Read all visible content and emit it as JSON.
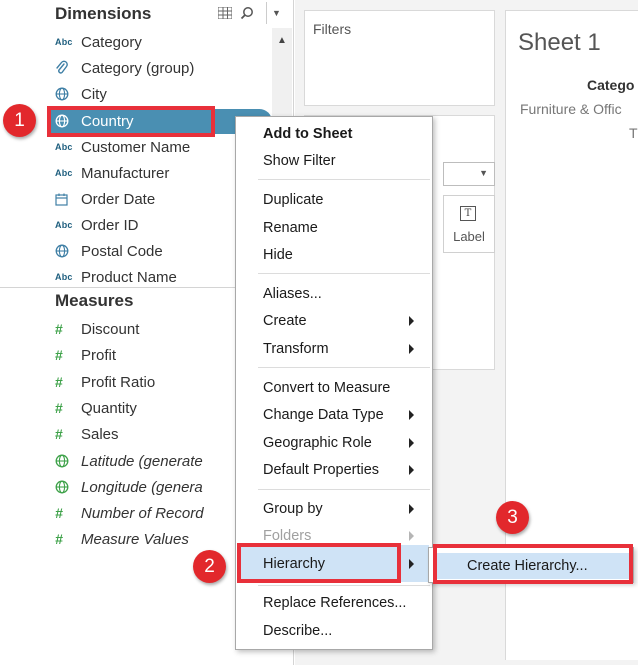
{
  "data_pane": {
    "dimensions_title": "Dimensions",
    "measures_title": "Measures",
    "tool_icons": [
      "view-toggle-icon",
      "search-icon",
      "chevron-down-icon"
    ],
    "dimensions": [
      {
        "label": "Category",
        "type": "abc",
        "icon_text": "Abc"
      },
      {
        "label": "Category (group)",
        "type": "paperclip"
      },
      {
        "label": "City",
        "type": "globe"
      },
      {
        "label": "Country",
        "type": "globe",
        "selected": true
      },
      {
        "label": "Customer Name",
        "type": "abc",
        "icon_text": "Abc"
      },
      {
        "label": "Manufacturer",
        "type": "abc",
        "icon_text": "Abc"
      },
      {
        "label": "Order Date",
        "type": "calendar"
      },
      {
        "label": "Order ID",
        "type": "abc",
        "icon_text": "Abc"
      },
      {
        "label": "Postal Code",
        "type": "globe"
      },
      {
        "label": "Product Name",
        "type": "abc",
        "icon_text": "Abc"
      }
    ],
    "measures": [
      {
        "label": "Discount",
        "type": "hash",
        "icon_text": "#"
      },
      {
        "label": "Profit",
        "type": "hash",
        "icon_text": "#"
      },
      {
        "label": "Profit Ratio",
        "type": "hash",
        "icon_text": "#"
      },
      {
        "label": "Quantity",
        "type": "hash",
        "icon_text": "#"
      },
      {
        "label": "Sales",
        "type": "hash",
        "icon_text": "#"
      },
      {
        "label": "Latitude (generate",
        "type": "globe",
        "italic": true
      },
      {
        "label": "Longitude (genera",
        "type": "globe",
        "italic": true
      },
      {
        "label": "Number of Record",
        "type": "hash",
        "icon_text": "#",
        "italic": true
      },
      {
        "label": "Measure Values",
        "type": "hash",
        "icon_text": "#",
        "italic": true
      }
    ]
  },
  "shelves": {
    "filters_title": "Filters",
    "label_card": "Label",
    "label_icon_text": "T"
  },
  "sheet": {
    "title": "Sheet 1",
    "header": "Catego",
    "sub": "Furniture & Offic",
    "tail": "T"
  },
  "context_menu": {
    "add_to_sheet": "Add to Sheet",
    "show_filter": "Show Filter",
    "duplicate": "Duplicate",
    "rename": "Rename",
    "hide": "Hide",
    "aliases": "Aliases...",
    "create": "Create",
    "transform": "Transform",
    "convert_to_measure": "Convert to Measure",
    "change_data_type": "Change Data Type",
    "geographic_role": "Geographic Role",
    "default_properties": "Default Properties",
    "group_by": "Group by",
    "folders": "Folders",
    "hierarchy": "Hierarchy",
    "replace_references": "Replace References...",
    "describe": "Describe..."
  },
  "submenu": {
    "create_hierarchy": "Create Hierarchy..."
  },
  "callouts": {
    "step1": "1",
    "step2": "2",
    "step3": "3",
    "color": "#e2282c"
  },
  "colors": {
    "selection_pill": "#4a8fb2",
    "menu_highlight": "#cfe3f6",
    "measure_icon": "#3fa24a"
  }
}
